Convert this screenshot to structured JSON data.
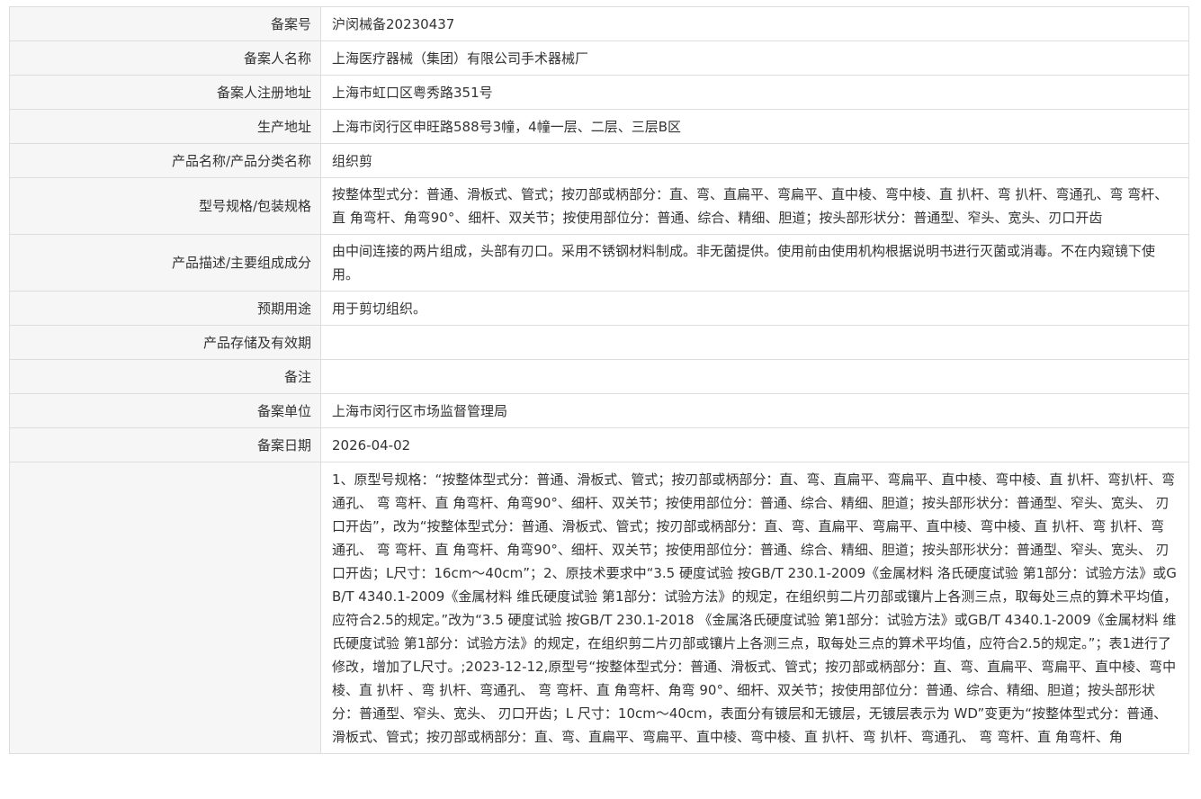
{
  "rows": [
    {
      "label": "备案号",
      "value": "沪闵械备20230437"
    },
    {
      "label": "备案人名称",
      "value": "上海医疗器械（集团）有限公司手术器械厂"
    },
    {
      "label": "备案人注册地址",
      "value": "上海市虹口区粤秀路351号"
    },
    {
      "label": "生产地址",
      "value": "上海市闵行区申旺路588号3幢，4幢一层、二层、三层B区"
    },
    {
      "label": "产品名称/产品分类名称",
      "value": "组织剪"
    },
    {
      "label": "型号规格/包装规格",
      "value": "按整体型式分：普通、滑板式、管式；按刃部或柄部分：直、弯、直扁平、弯扁平、直中棱、弯中棱、直 扒杆、弯 扒杆、弯通孔、弯 弯杆、直 角弯杆、角弯90°、细杆、双关节；按使用部位分：普通、综合、精细、胆道；按头部形状分：普通型、窄头、宽头、刃口开齿"
    },
    {
      "label": "产品描述/主要组成成分",
      "value": "由中间连接的两片组成，头部有刃口。采用不锈钢材料制成。非无菌提供。使用前由使用机构根据说明书进行灭菌或消毒。不在内窥镜下使用。"
    },
    {
      "label": "预期用途",
      "value": "用于剪切组织。"
    },
    {
      "label": "产品存储及有效期",
      "value": ""
    },
    {
      "label": "备注",
      "value": ""
    },
    {
      "label": "备案单位",
      "value": "上海市闵行区市场监督管理局"
    },
    {
      "label": "备案日期",
      "value": "2026-04-02"
    }
  ],
  "change_row": {
    "label": "",
    "value": "1、原型号规格：“按整体型式分：普通、滑板式、管式；按刃部或柄部分：直、弯、直扁平、弯扁平、直中棱、弯中棱、直 扒杆、弯扒杆、弯通孔、 弯 弯杆、直 角弯杆、角弯90°、细杆、双关节；按使用部位分：普通、综合、精细、胆道；按头部形状分：普通型、窄头、宽头、 刃口开齿”，改为“按整体型式分：普通、滑板式、管式；按刃部或柄部分：直、弯、直扁平、弯扁平、直中棱、弯中棱、直 扒杆、弯 扒杆、弯通孔、 弯 弯杆、直 角弯杆、角弯90°、细杆、双关节；按使用部位分：普通、综合、精细、胆道；按头部形状分：普通型、窄头、宽头、 刃口开齿；L尺寸：16cm～40cm”；2、原技术要求中“3.5 硬度试验 按GB/T 230.1-2009《金属材料 洛氏硬度试验 第1部分：试验方法》或GB/T 4340.1-2009《金属材料 维氏硬度试验 第1部分：试验方法》的规定，在组织剪二片刃部或镶片上各测三点，取每处三点的算术平均值，应符合2.5的规定。”改为“3.5 硬度试验 按GB/T 230.1-2018 《金属洛氏硬度试验 第1部分：试验方法》或GB/T 4340.1-2009《金属材料 维氏硬度试验 第1部分：试验方法》的规定，在组织剪二片刃部或镶片上各测三点，取每处三点的算术平均值，应符合2.5的规定。”；表1进行了修改，增加了L尺寸。;2023-12-12,原型号“按整体型式分：普通、滑板式、管式；按刃部或柄部分：直、弯、直扁平、弯扁平、直中棱、弯中棱、直 扒杆 、弯 扒杆、弯通孔、 弯 弯杆、直 角弯杆、角弯 90°、细杆、双关节；按使用部位分：普通、综合、精细、胆道；按头部形状分：普通型、窄头、宽头、 刃口开齿；L 尺寸：10cm～40cm，表面分有镀层和无镀层，无镀层表示为 WD”变更为“按整体型式分：普通、滑板式、管式；按刃部或柄部分：直、弯、直扁平、弯扁平、直中棱、弯中棱、直 扒杆、弯 扒杆、弯通孔、 弯 弯杆、直 角弯杆、角"
  }
}
